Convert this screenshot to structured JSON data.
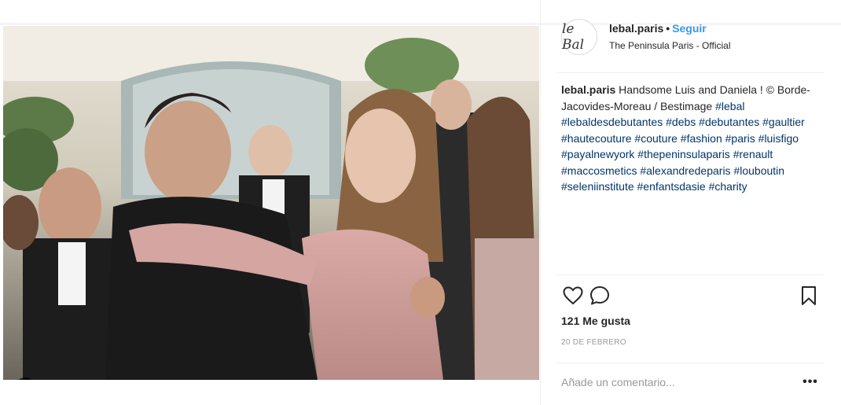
{
  "post": {
    "username": "lebal.paris",
    "separator": "•",
    "follow_label": "Seguir",
    "location": "The Peninsula Paris - Official",
    "avatar_text": "le Bal"
  },
  "caption": {
    "username": "lebal.paris",
    "text": "Handsome Luis and Daniela ! © Borde-Jacovides-Moreau / Bestimage",
    "hashtags": [
      "#lebal",
      "#lebaldesdebutantes",
      "#debs",
      "#debutantes",
      "#gaultier",
      "#hautecouture",
      "#couture",
      "#fashion",
      "#paris",
      "#luisfigo",
      "#payalnewyork",
      "#thepeninsulaparis",
      "#renault",
      "#maccosmetics",
      "#alexandredeparis",
      "#louboutin",
      "#seleniinstitute",
      "#enfantsdasie",
      "#charity"
    ]
  },
  "actions": {
    "like_icon": "heart-outline-icon",
    "comment_icon": "speech-bubble-icon",
    "save_icon": "bookmark-icon"
  },
  "likes_text": "121 Me gusta",
  "date_text": "20 DE FEBRERO",
  "comment_input": {
    "placeholder": "Añade un comentario...",
    "value": ""
  },
  "more_label": "•••",
  "colors": {
    "link": "#3897f0",
    "hashtag": "#003569",
    "text": "#262626",
    "muted": "#999999"
  }
}
